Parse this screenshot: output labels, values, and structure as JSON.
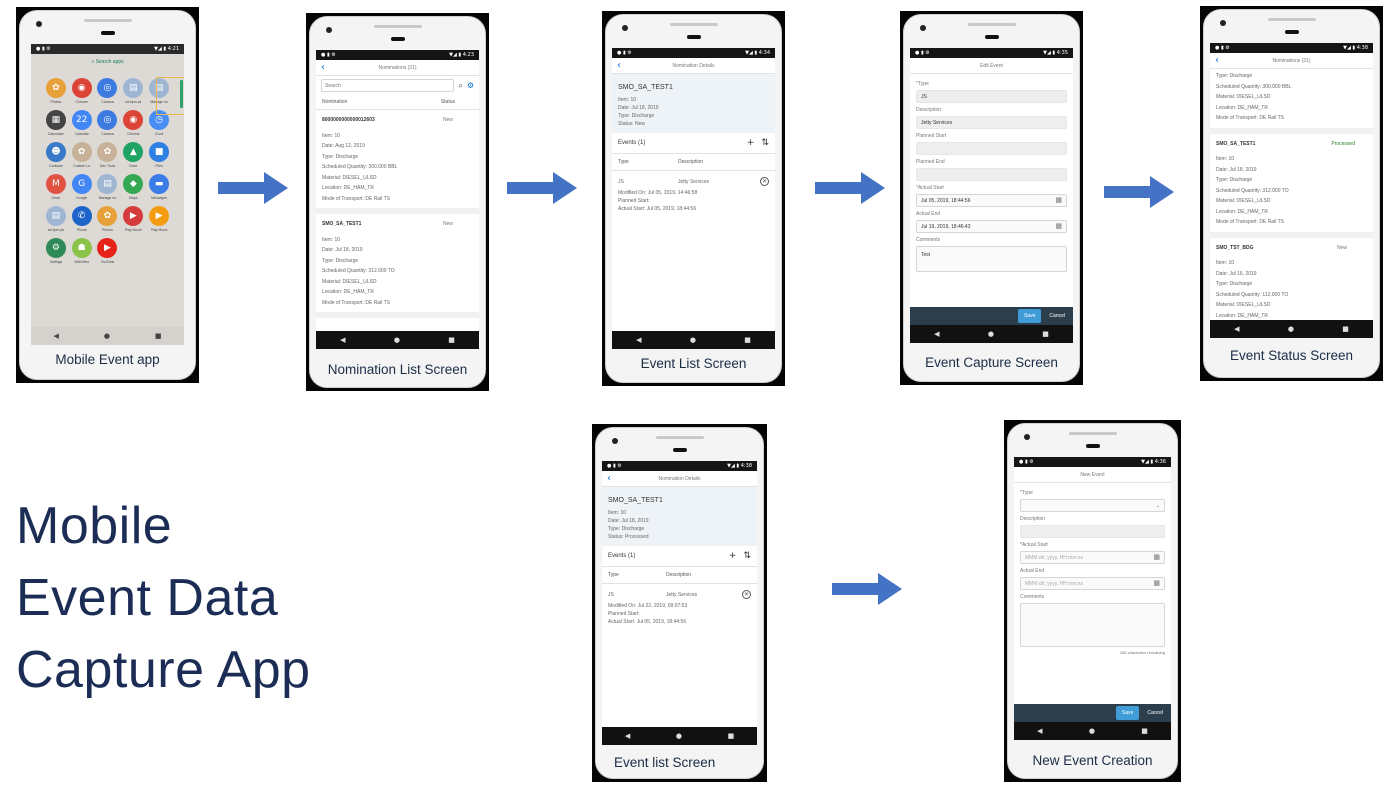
{
  "title_lines": [
    "Mobile",
    "Event Data",
    "Capture App"
  ],
  "captions": {
    "launcher": "Mobile Event app",
    "nomination_list": "Nomination List Screen",
    "event_list": "Event List Screen",
    "event_capture": "Event Capture Screen",
    "event_status": "Event Status Screen",
    "event_list_2": "Event list Screen",
    "new_event": "New Event Creation"
  },
  "colors": {
    "accent": "#0a6ed1",
    "title": "#1b2c55",
    "arrow": "#4472c4",
    "highlight": "#e8b84c"
  },
  "launcher": {
    "status_time": "4:21",
    "search_label": "Search apps",
    "apps": [
      {
        "name": "Photos",
        "icon": "photos-icon",
        "glyph": "✿",
        "color": "#e7a13a"
      },
      {
        "name": "Chrome",
        "icon": "chrome-icon",
        "glyph": "◉",
        "color": "#db4437"
      },
      {
        "name": "Camera",
        "icon": "camera-icon",
        "glyph": "◎",
        "color": "#3d7be0"
      },
      {
        "name": "sd-bpm.pk",
        "icon": "document-icon",
        "glyph": "▤",
        "color": "#9fb6d3"
      },
      {
        "name": "Manage no",
        "icon": "document-icon",
        "glyph": "▤",
        "color": "#9fb6d3"
      },
      {
        "name": "Calculator",
        "icon": "calculator-icon",
        "glyph": "▦",
        "color": "#444444"
      },
      {
        "name": "Calendar",
        "icon": "calendar-icon",
        "glyph": "22",
        "color": "#4285f4"
      },
      {
        "name": "Camera",
        "icon": "camera-icon",
        "glyph": "◎",
        "color": "#3d7be0"
      },
      {
        "name": "Chrome",
        "icon": "chrome-icon",
        "glyph": "◉",
        "color": "#db4437"
      },
      {
        "name": "Clock",
        "icon": "clock-icon",
        "glyph": "◷",
        "color": "#4a8ef5"
      },
      {
        "name": "Contacts",
        "icon": "contacts-icon",
        "glyph": "☻",
        "color": "#3a79c9"
      },
      {
        "name": "Custom Lo",
        "icon": "pinwheel-icon",
        "glyph": "✿",
        "color": "#c7b299"
      },
      {
        "name": "Dev Tools",
        "icon": "pinwheel-icon",
        "glyph": "✿",
        "color": "#c7b299"
      },
      {
        "name": "Drive",
        "icon": "drive-icon",
        "glyph": "▲",
        "color": "#1fa463"
      },
      {
        "name": "Files",
        "icon": "files-icon",
        "glyph": "■",
        "color": "#2f80e3"
      },
      {
        "name": "Gmail",
        "icon": "gmail-icon",
        "glyph": "M",
        "color": "#e25240"
      },
      {
        "name": "Google",
        "icon": "google-icon",
        "glyph": "G",
        "color": "#4285f4"
      },
      {
        "name": "Manage no",
        "icon": "document-icon",
        "glyph": "▤",
        "color": "#9fb6d3"
      },
      {
        "name": "Maps",
        "icon": "maps-icon",
        "glyph": "◆",
        "color": "#34a853"
      },
      {
        "name": "Messages",
        "icon": "messages-icon",
        "glyph": "▬",
        "color": "#3b7be8"
      },
      {
        "name": "sd-bpm.pk",
        "icon": "document-icon",
        "glyph": "▤",
        "color": "#9fb6d3"
      },
      {
        "name": "Phone",
        "icon": "phone-icon",
        "glyph": "✆",
        "color": "#1e63c9"
      },
      {
        "name": "Photos",
        "icon": "photos-icon",
        "glyph": "✿",
        "color": "#e7a13a"
      },
      {
        "name": "Play Movie",
        "icon": "play-movies-icon",
        "glyph": "▶",
        "color": "#d63b3b"
      },
      {
        "name": "Play Music",
        "icon": "play-music-icon",
        "glyph": "▶",
        "color": "#f39c12"
      },
      {
        "name": "Settings",
        "icon": "settings-icon",
        "glyph": "⚙",
        "color": "#2e8b57"
      },
      {
        "name": "WebView",
        "icon": "android-icon",
        "glyph": "☗",
        "color": "#8bc34a"
      },
      {
        "name": "YouTube",
        "icon": "youtube-icon",
        "glyph": "▶",
        "color": "#e62117"
      }
    ]
  },
  "nomination_list": {
    "status_time": "4:23",
    "header": "Nominations (31)",
    "search_placeholder": "Search",
    "col_nomination": "Nomination",
    "col_status": "Status",
    "items": [
      {
        "id": "8000000000000012603",
        "status": "New",
        "item": "Item: 10",
        "date": "Date: Aug 12, 2019",
        "type": "Type: Discharge",
        "qty": "Scheduled Quantity: 300.000 BBL",
        "material": "Material: DIESEL_ULSD",
        "location": "Location: DE_HAM_TR",
        "mode": "Mode of Transport: DE Rail TS"
      },
      {
        "id": "SMO_SA_TEST1",
        "status": "New",
        "item": "Item: 10",
        "date": "Date: Jul 18, 2019",
        "type": "Type: Discharge",
        "qty": "Scheduled Quantity: 312.000 TO",
        "material": "Material: DIESEL_ULSD",
        "location": "Location: DE_HAM_TR",
        "mode": "Mode of Transport: DE Rail TS"
      }
    ]
  },
  "event_list": {
    "status_time": "4:34",
    "header": "Nomination Details",
    "object": "SMO_SA_TEST1",
    "item": "Item: 10",
    "date": "Date: Jul 18, 2019",
    "type": "Type: Discharge",
    "status": "Status: New",
    "events_title": "Events (1)",
    "col_type": "Type",
    "col_desc": "Description",
    "event": {
      "code": "JS",
      "desc": "Jetty Services",
      "modified": "Modified On: Jul 05, 2019, 14:46:58",
      "planned": "Planned Start:",
      "actual": "Actual Start: Jul 05, 2019, 18:44:56"
    }
  },
  "event_capture": {
    "status_time": "4:35",
    "header": "Edit Event",
    "type_label": "*Type",
    "type_value": "JS",
    "desc_label": "Description",
    "desc_value": "Jetty Services",
    "planned_start_label": "Planned Start",
    "planned_end_label": "Planned End",
    "actual_start_label": "*Actual Start",
    "actual_start_value": "Jul 05, 2019, 18:44:56",
    "actual_end_label": "Actual End",
    "actual_end_value": "Jul 19, 2019, 18:46:43",
    "comments_label": "Comments",
    "comments_value": "Test",
    "save": "Save",
    "cancel": "Cancel"
  },
  "event_status": {
    "status_time": "4:38",
    "header": "Nominations (31)",
    "top": {
      "type": "Type: Discharge",
      "qty": "Scheduled Quantity: 300.000 BBL",
      "material": "Material: DIESEL_ULSD",
      "location": "Location: DE_HAM_TR",
      "mode": "Mode of Transport: DE Rail TS"
    },
    "items": [
      {
        "id": "SMO_SA_TEST1",
        "status": "Processed",
        "item": "Item: 10",
        "date": "Date: Jul 18, 2019",
        "type": "Type: Discharge",
        "qty": "Scheduled Quantity: 312.000 TO",
        "material": "Material: DIESEL_ULSD",
        "location": "Location: DE_HAM_TR",
        "mode": "Mode of Transport: DE Rail TS"
      },
      {
        "id": "SMO_TST_BDG",
        "status": "New",
        "item": "Item: 10",
        "date": "Date: Jul 16, 2019",
        "type": "Type: Discharge",
        "qty": "Scheduled Quantity: 112.000 TO",
        "material": "Material: DIESEL_ULSD",
        "location": "Location: DE_HAM_TR"
      }
    ]
  },
  "event_list_2": {
    "status_time": "4:38",
    "header": "Nomination Details",
    "object": "SMO_SA_TEST1",
    "item": "Item: 10",
    "date": "Date: Jul 18, 2019",
    "type": "Type: Discharge",
    "status": "Status: Processed",
    "events_title": "Events (1)",
    "col_type": "Type",
    "col_desc": "Description",
    "event": {
      "code": "JS",
      "desc": "Jetty Services",
      "modified": "Modified On: Jul 22, 2019, 09:07:53",
      "planned": "Planned Start:",
      "actual": "Actual Start: Jul 05, 2019, 18:44:56"
    }
  },
  "new_event": {
    "status_time": "4:36",
    "header": "New Event",
    "type_label": "*Type",
    "desc_label": "Description",
    "actual_start_label": "*Actual Start",
    "actual_start_placeholder": "MMM dd, yyyy, HH:mm:ss",
    "actual_end_label": "Actual End",
    "actual_end_placeholder": "MMM dd, yyyy, HH:mm:ss",
    "comments_label": "Comments",
    "remaining": "256 characters remaining",
    "save": "Save",
    "cancel": "Cancel"
  }
}
